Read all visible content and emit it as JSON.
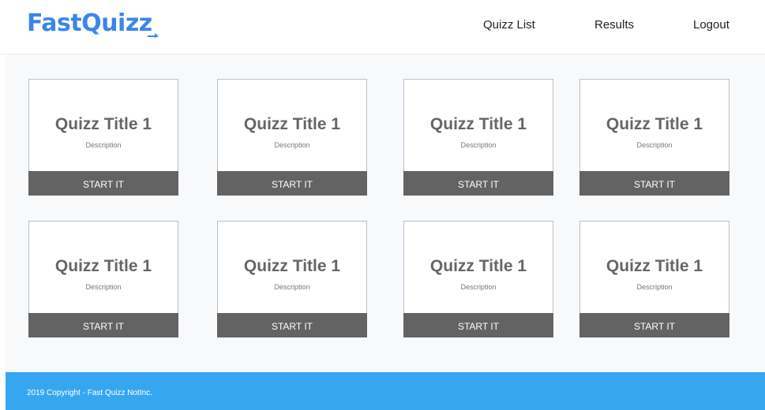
{
  "header": {
    "logo_text": "FastQuizz",
    "nav": {
      "quizz_list": "Quizz List",
      "results": "Results",
      "logout": "Logout"
    }
  },
  "colors": {
    "brand": "#3a86e8",
    "footer": "#37a6f0",
    "button": "#636363"
  },
  "quizzes": [
    {
      "title": "Quizz Title 1",
      "description": "Description",
      "button": "START IT"
    },
    {
      "title": "Quizz Title 1",
      "description": "Description",
      "button": "START IT"
    },
    {
      "title": "Quizz Title 1",
      "description": "Description",
      "button": "START IT"
    },
    {
      "title": "Quizz Title 1",
      "description": "Description",
      "button": "START IT"
    },
    {
      "title": "Quizz Title 1",
      "description": "Description",
      "button": "START IT"
    },
    {
      "title": "Quizz Title 1",
      "description": "Description",
      "button": "START IT"
    },
    {
      "title": "Quizz Title 1",
      "description": "Description",
      "button": "START IT"
    },
    {
      "title": "Quizz Title 1",
      "description": "Description",
      "button": "START IT"
    }
  ],
  "footer": {
    "copyright": "2019 Copyright - Fast Quizz NotInc."
  }
}
